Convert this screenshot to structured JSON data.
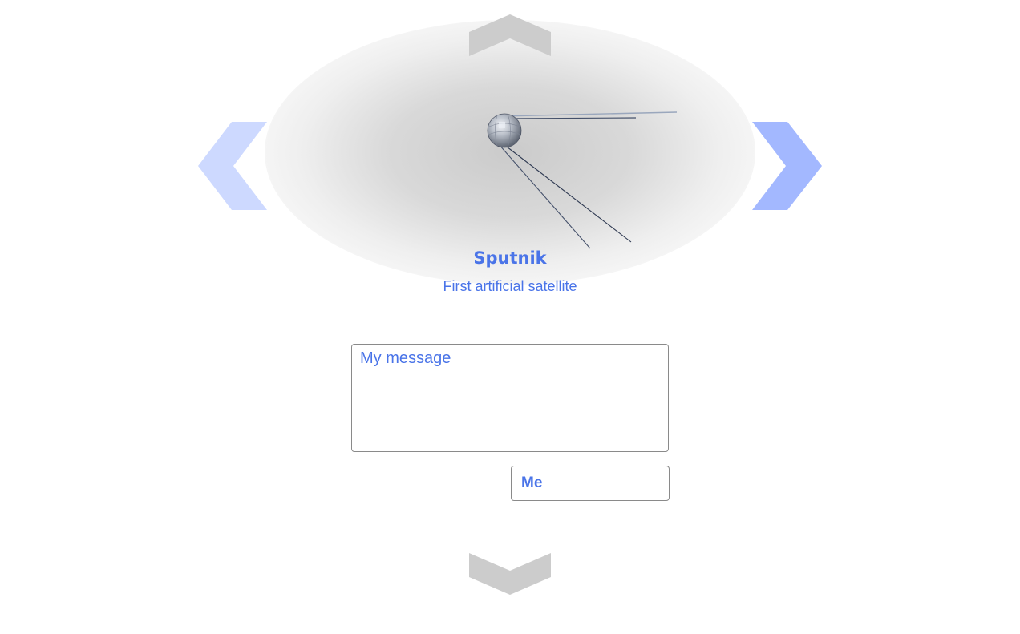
{
  "item": {
    "title": "Sputnik",
    "subtitle": "First artificial satellite"
  },
  "form": {
    "message_placeholder": "My message",
    "name_value": "Me"
  },
  "icons": {
    "up": "chevron-up-icon",
    "down": "chevron-down-icon",
    "left": "chevron-left-icon",
    "right": "chevron-right-icon",
    "satellite": "sputnik-satellite-image"
  },
  "colors": {
    "accent": "#4a74e8",
    "nav_arrow_vertical": "#cccccc",
    "nav_arrow_left": "#cdd9ff",
    "nav_arrow_right": "#a3b8ff",
    "backdrop": "#d3d3d3"
  }
}
